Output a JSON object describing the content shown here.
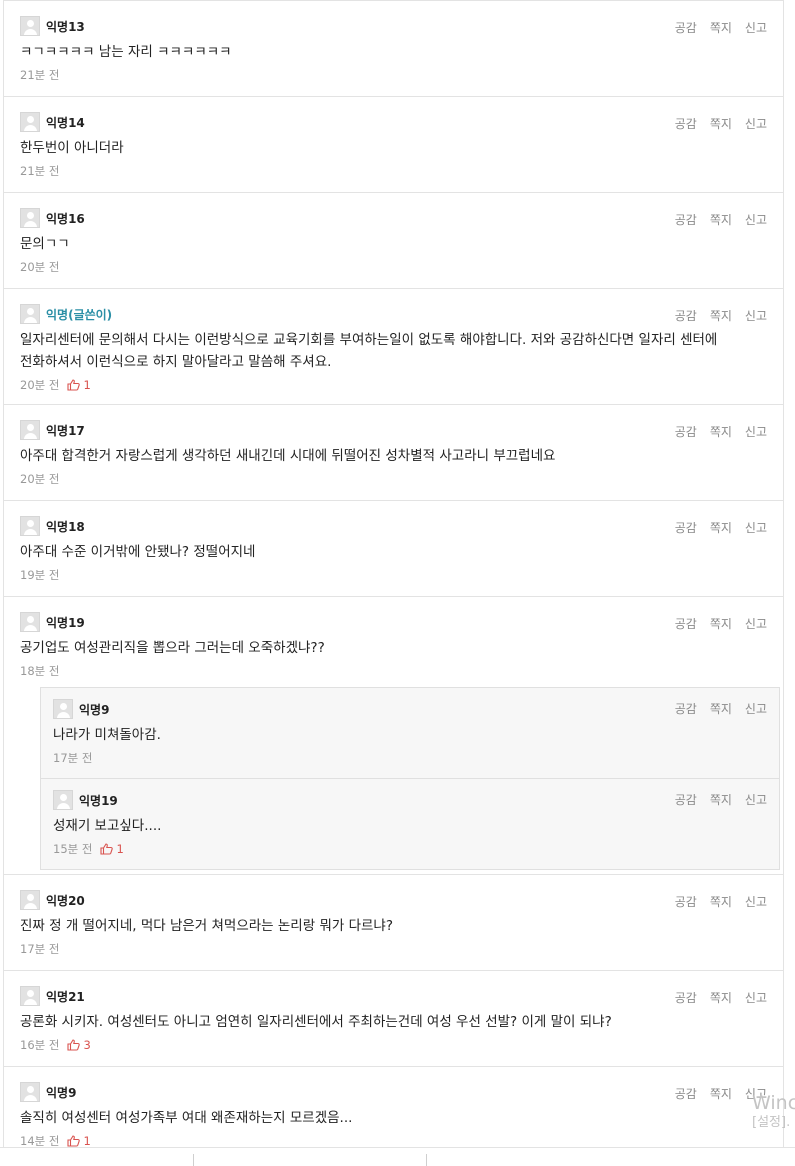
{
  "comments": [
    {
      "nick": "익명13",
      "text": "ㅋㄱㅋㅋㅋㅋ 남는 자리 ㅋㅋㅋㅋㅋㅋ",
      "time": "21분 전",
      "likes": ""
    },
    {
      "nick": "익명14",
      "text": "한두번이 아니더라",
      "time": "21분 전",
      "likes": ""
    },
    {
      "nick": "익명16",
      "text": "문의ㄱㄱ",
      "time": "20분 전",
      "likes": ""
    },
    {
      "nick": "익명(글쓴이)",
      "text": "일자리센터에 문의해서 다시는 이런방식으로 교육기회를 부여하는일이 없도록 해야합니다. 저와 공감하신다면 일자리 센터에 전화하셔서 이런식으로 하지 말아달라고 말씀해 주셔요.",
      "time": "20분 전",
      "likes": "1",
      "writer": true
    },
    {
      "nick": "익명17",
      "text": "아주대 합격한거 자랑스럽게 생각하던 새내긴데 시대에 뒤떨어진 성차별적 사고라니 부끄럽네요",
      "time": "20분 전",
      "likes": ""
    },
    {
      "nick": "익명18",
      "text": "아주대 수준 이거밖에 안됐나? 정떨어지네",
      "time": "19분 전",
      "likes": ""
    },
    {
      "nick": "익명19",
      "text": "공기업도 여성관리직을 뽑으라 그러는데 오죽하겠냐??",
      "time": "18분 전",
      "likes": ""
    },
    {
      "nick": "익명20",
      "text": "진짜 정 개 떨어지네, 먹다 남은거 쳐먹으라는 논리랑 뭐가 다르냐?",
      "time": "17분 전",
      "likes": ""
    },
    {
      "nick": "익명21",
      "text": "공론화 시키자. 여성센터도 아니고 엄연히 일자리센터에서 주최하는건데 여성 우선 선발? 이게 말이 되냐?",
      "time": "16분 전",
      "likes": "3"
    },
    {
      "nick": "익명9",
      "text": "솔직히 여성센터 여성가족부 여대 왜존재하는지 모르겠음...",
      "time": "14분 전",
      "likes": "1"
    }
  ],
  "replies": [
    {
      "nick": "익명9",
      "text": "나라가 미쳐돌아감.",
      "time": "17분 전",
      "likes": ""
    },
    {
      "nick": "익명19",
      "text": "성재기 보고싶다....",
      "time": "15분 전",
      "likes": "1"
    }
  ],
  "actions": {
    "like": "공감",
    "message": "쪽지",
    "report": "신고"
  },
  "watermark": {
    "line1": "Winc",
    "line2": "[설정]."
  },
  "colors": {
    "writer": "#2b8fa6",
    "like": "#d9534f"
  },
  "icons": {
    "like": "thumbs-up-icon",
    "avatar": "default-avatar-icon"
  }
}
